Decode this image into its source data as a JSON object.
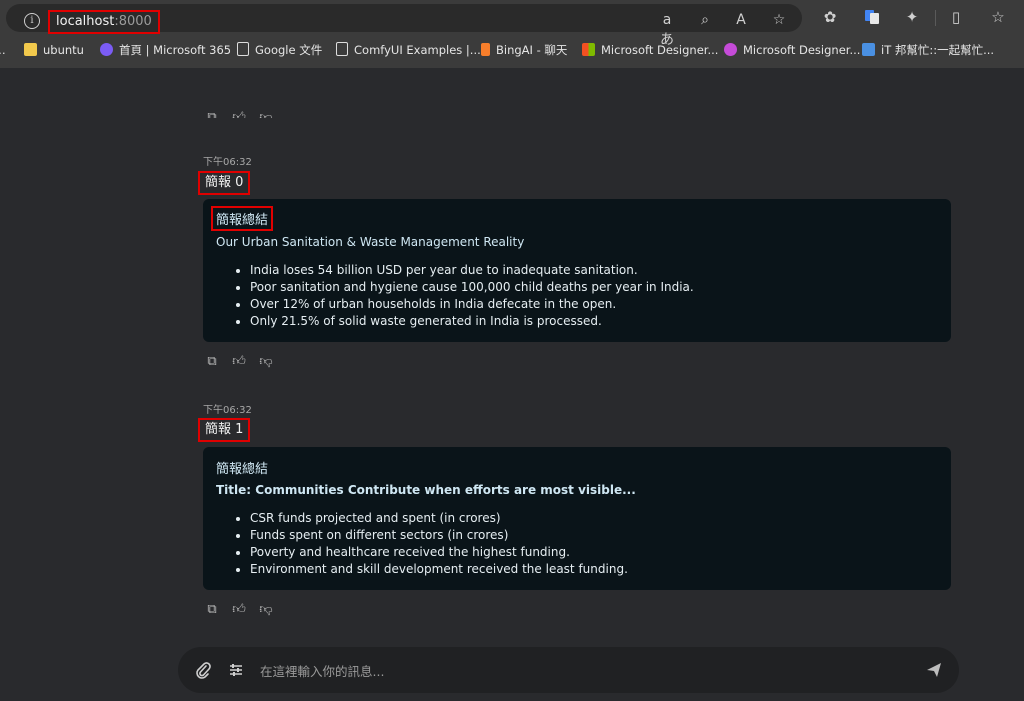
{
  "browser": {
    "url_host": "localhost",
    "url_port": ":8000",
    "bookmarks": [
      {
        "label": "ubuntu",
        "icon": "folder-icon",
        "color": "#f2c94c"
      },
      {
        "label": "首頁 | Microsoft 365",
        "icon": "m365-icon",
        "color": "#7b5cf5"
      },
      {
        "label": "Google 文件",
        "icon": "document-icon",
        "color": "#dddddd"
      },
      {
        "label": "ComfyUI Examples |...",
        "icon": "document-icon",
        "color": "#dddddd"
      },
      {
        "label": "BingAI - 聊天",
        "icon": "bing-icon",
        "color": "#f77e2b"
      },
      {
        "label": "Microsoft Designer...",
        "icon": "microsoft-logo-icon",
        "color": "#f25022"
      },
      {
        "label": "Microsoft Designer...",
        "icon": "designer-icon",
        "color": "#c54bd8"
      },
      {
        "label": "iT 邦幫忙::一起幫忙...",
        "icon": "ithome-icon",
        "color": "#4a90e2"
      }
    ]
  },
  "messages": [
    {
      "time": "下午06:32",
      "title": "簡報 0",
      "heading": "簡報總結",
      "subtitle": "Our Urban Sanitation & Waste Management Reality",
      "bullets": [
        "India loses 54 billion USD per year due to inadequate sanitation.",
        "Poor sanitation and hygiene cause 100,000 child deaths per year in India.",
        "Over 12% of urban households in India defecate in the open.",
        "Only 21.5% of solid waste generated in India is processed."
      ]
    },
    {
      "time": "下午06:32",
      "title": "簡報 1",
      "heading": "簡報總結",
      "subtitle": "Title: Communities Contribute when efforts are most visible...",
      "bullets": [
        "CSR funds projected and spent (in crores)",
        "Funds spent on different sectors (in crores)",
        "Poverty and healthcare received the highest funding.",
        "Environment and skill development received the least funding."
      ]
    }
  ],
  "composer": {
    "placeholder": "在這裡輸入你的訊息..."
  },
  "colors": {
    "highlight_box": "#e00000",
    "card_bg": "#0a1419",
    "page_bg": "#292a2d"
  }
}
